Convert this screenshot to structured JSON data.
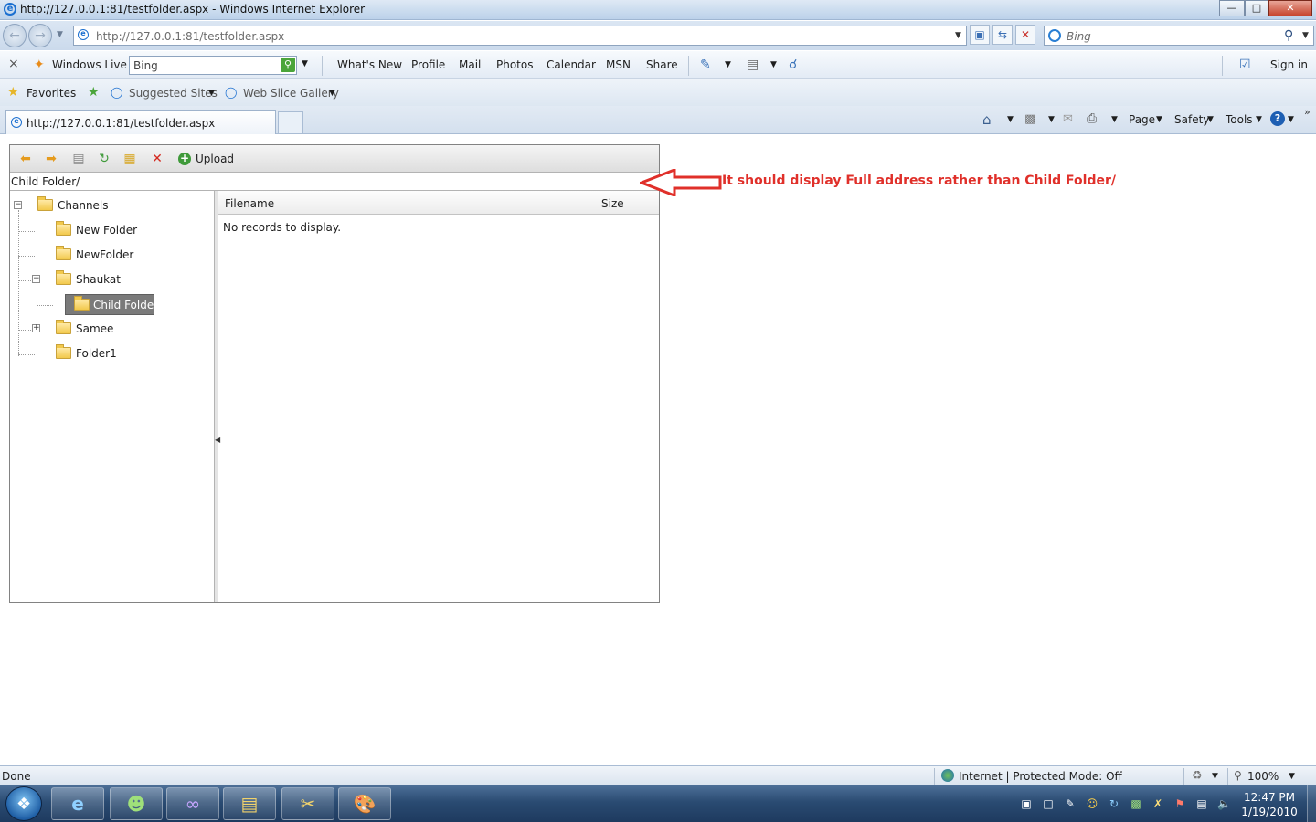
{
  "window": {
    "title": "http://127.0.0.1:81/testfolder.aspx - Windows Internet Explorer",
    "min_label": "—",
    "max_label": "□",
    "close_label": "✕"
  },
  "address_bar": {
    "url": "http://127.0.0.1:81/testfolder.aspx",
    "search_placeholder": "Bing"
  },
  "windows_live": {
    "brand": "Windows Live",
    "search_value": "Bing",
    "links": [
      "What's New",
      "Profile",
      "Mail",
      "Photos",
      "Calendar",
      "MSN",
      "Share"
    ],
    "sign_in": "Sign in"
  },
  "favorites_bar": {
    "favorites": "Favorites",
    "suggested_sites": "Suggested Sites",
    "web_slice_gallery": "Web Slice Gallery"
  },
  "tabs": [
    {
      "label": "http://127.0.0.1:81/testfolder.aspx"
    }
  ],
  "command_bar": {
    "page": "Page",
    "safety": "Safety",
    "tools": "Tools"
  },
  "file_explorer": {
    "upload_label": "Upload",
    "current_path": "Child Folder/",
    "tree": {
      "root": "Channels",
      "items": [
        "New Folder",
        "NewFolder",
        "Shaukat",
        "Child Folder",
        "Samee",
        "Folder1"
      ],
      "selected": "Child Folder"
    },
    "grid": {
      "columns": [
        "Filename",
        "Size"
      ],
      "empty_message": "No records to display."
    }
  },
  "annotation": {
    "text": "It should display Full address rather than Child Folder/",
    "color": "#e0302a"
  },
  "status_bar": {
    "status": "Done",
    "zone": "Internet | Protected Mode: Off",
    "zoom": "100%"
  },
  "taskbar": {
    "time": "12:47 PM",
    "date": "1/19/2010"
  }
}
